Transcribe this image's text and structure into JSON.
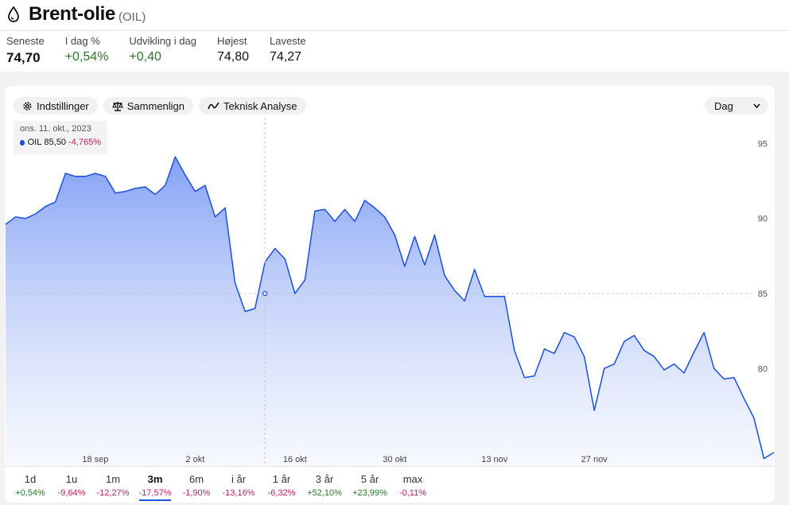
{
  "header": {
    "title": "Brent-olie",
    "ticker": "(OIL)"
  },
  "stats": [
    {
      "label": "Seneste",
      "value": "74,70",
      "tone": "plain"
    },
    {
      "label": "I dag %",
      "value": "+0,54%",
      "tone": "pos"
    },
    {
      "label": "Udvikling i dag",
      "value": "+0,40",
      "tone": "pos"
    },
    {
      "label": "Højest",
      "value": "74,80",
      "tone": "normal"
    },
    {
      "label": "Laveste",
      "value": "74,27",
      "tone": "normal"
    }
  ],
  "toolbar": {
    "settings_label": "Indstillinger",
    "compare_label": "Sammenlign",
    "technical_label": "Teknisk Analyse",
    "interval_label": "Dag"
  },
  "tooltip": {
    "date": "ons. 11. okt., 2023",
    "series": "OIL",
    "value": "85,50",
    "change": "-4,765%"
  },
  "colors": {
    "line": "#1a4fe0",
    "positive": "#2a7a2a",
    "negative": "#c0205a"
  },
  "chart_data": {
    "type": "area",
    "x": [
      "2023-09-05",
      "2023-09-06",
      "2023-09-07",
      "2023-09-08",
      "2023-09-11",
      "2023-09-12",
      "2023-09-13",
      "2023-09-14",
      "2023-09-15",
      "2023-09-18",
      "2023-09-19",
      "2023-09-20",
      "2023-09-21",
      "2023-09-22",
      "2023-09-25",
      "2023-09-26",
      "2023-09-27",
      "2023-09-28",
      "2023-09-29",
      "2023-10-02",
      "2023-10-03",
      "2023-10-04",
      "2023-10-05",
      "2023-10-06",
      "2023-10-09",
      "2023-10-10",
      "2023-10-11",
      "2023-10-12",
      "2023-10-13",
      "2023-10-16",
      "2023-10-17",
      "2023-10-18",
      "2023-10-19",
      "2023-10-20",
      "2023-10-23",
      "2023-10-24",
      "2023-10-25",
      "2023-10-26",
      "2023-10-27",
      "2023-10-30",
      "2023-10-31",
      "2023-11-01",
      "2023-11-02",
      "2023-11-03",
      "2023-11-06",
      "2023-11-07",
      "2023-11-08",
      "2023-11-09",
      "2023-11-10",
      "2023-11-13",
      "2023-11-14",
      "2023-11-15",
      "2023-11-16",
      "2023-11-17",
      "2023-11-20",
      "2023-11-21",
      "2023-11-22",
      "2023-11-23",
      "2023-11-24",
      "2023-11-27",
      "2023-11-28",
      "2023-11-29",
      "2023-11-30",
      "2023-12-01",
      "2023-12-04",
      "2023-12-05",
      "2023-12-06",
      "2023-12-07",
      "2023-12-08"
    ],
    "series": [
      {
        "name": "OIL",
        "values": [
          89.6,
          90.1,
          90.0,
          90.3,
          90.8,
          91.1,
          93.0,
          92.8,
          92.8,
          93.0,
          92.8,
          91.7,
          91.8,
          92.0,
          92.1,
          91.6,
          92.2,
          94.1,
          92.9,
          91.8,
          92.2,
          90.1,
          90.7,
          85.7,
          83.8,
          84.0,
          87.1,
          88.0,
          87.3,
          85.0,
          85.9,
          90.5,
          90.6,
          89.8,
          90.6,
          89.8,
          91.2,
          90.7,
          90.1,
          88.9,
          86.8,
          88.8,
          86.9,
          88.9,
          86.2,
          85.2,
          84.5,
          86.6,
          84.8,
          84.8,
          84.8,
          81.2,
          79.4,
          79.5,
          81.3,
          81.0,
          82.4,
          82.1,
          80.8,
          77.2,
          80.0,
          80.3,
          81.8,
          82.2,
          81.2,
          80.8,
          79.9,
          80.3,
          79.7,
          81.1,
          82.4,
          80.0,
          79.3,
          79.4,
          78.0,
          76.7,
          74.0,
          74.4
        ],
        "color": "#1a4fe0"
      }
    ],
    "y_ticks": [
      80,
      85,
      90,
      95
    ],
    "x_tick_labels": [
      "18 sep",
      "2 okt",
      "16 okt",
      "30 okt",
      "13 nov",
      "27 nov"
    ],
    "ylim": [
      73.5,
      96.5
    ],
    "crosshair": {
      "x": "2023-10-11",
      "y": 85.0
    },
    "grid": false,
    "y_axis_position": "right"
  },
  "ranges": [
    {
      "label": "1d",
      "change": "+0,54%",
      "tone": "pos",
      "active": false
    },
    {
      "label": "1u",
      "change": "-9,64%",
      "tone": "neg",
      "active": false
    },
    {
      "label": "1m",
      "change": "-12,27%",
      "tone": "neg",
      "active": false
    },
    {
      "label": "3m",
      "change": "-17,57%",
      "tone": "neg",
      "active": true
    },
    {
      "label": "6m",
      "change": "-1,90%",
      "tone": "neg",
      "active": false
    },
    {
      "label": "i år",
      "change": "-13,16%",
      "tone": "neg",
      "active": false
    },
    {
      "label": "1 år",
      "change": "-6,32%",
      "tone": "neg",
      "active": false
    },
    {
      "label": "3 år",
      "change": "+52,10%",
      "tone": "pos",
      "active": false
    },
    {
      "label": "5 år",
      "change": "+23,99%",
      "tone": "pos",
      "active": false
    },
    {
      "label": "max",
      "change": "-0,11%",
      "tone": "neg",
      "active": false
    }
  ]
}
